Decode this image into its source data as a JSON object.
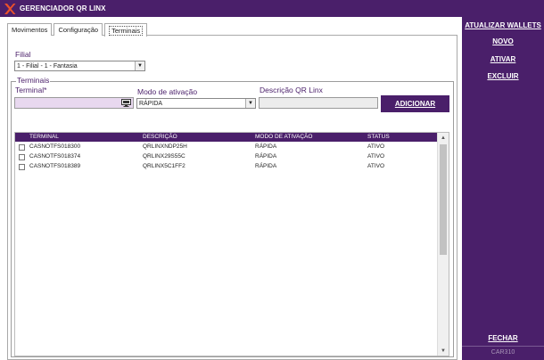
{
  "window": {
    "title": "GERENCIADOR QR LINX",
    "logo_icon": "linx-x-logo-icon"
  },
  "tabs": [
    {
      "label": "Movimentos",
      "active": false
    },
    {
      "label": "Configuração",
      "active": false
    },
    {
      "label": "Terminais",
      "active": true
    }
  ],
  "filial": {
    "label": "Filial",
    "value": "1 - Filial - 1 - Fantasia"
  },
  "terminais_group": {
    "legend": "Terminais",
    "terminal_label": "Terminal*",
    "terminal_value": "",
    "terminal_icon": "monitor-icon",
    "modo_label": "Modo de ativação",
    "modo_value": "RÁPIDA",
    "descricao_label": "Descrição QR Linx",
    "descricao_value": "",
    "add_button": "ADICIONAR"
  },
  "grid": {
    "columns": [
      "TERMINAL",
      "DESCRIÇÃO",
      "MODO DE ATIVAÇÃO",
      "STATUS"
    ],
    "rows": [
      {
        "terminal": "CASNOTFS018300",
        "descricao": "QRLINXNDP25H",
        "modo": "RÁPIDA",
        "status": "ATIVO"
      },
      {
        "terminal": "CASNOTFS018374",
        "descricao": "QRLINX29S55C",
        "modo": "RÁPIDA",
        "status": "ATIVO"
      },
      {
        "terminal": "CASNOTFS018389",
        "descricao": "QRLINX5C1FF2",
        "modo": "RÁPIDA",
        "status": "ATIVO"
      }
    ]
  },
  "sidebar": {
    "atualizar": "ATUALIZAR WALLETS",
    "novo": "NOVO",
    "ativar": "ATIVAR",
    "excluir": "EXCLUIR",
    "fechar": "FECHAR",
    "version": "CAR310"
  },
  "colors": {
    "brand": "#4a1f6a",
    "accent": "#e8512b",
    "input_highlight": "#e8d8ef"
  }
}
